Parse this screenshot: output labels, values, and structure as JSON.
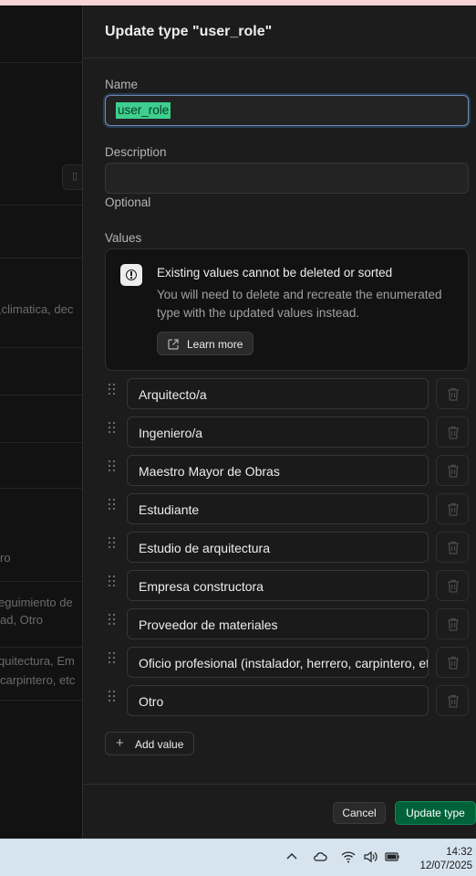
{
  "panel": {
    "title": "Update type \"user_role\"",
    "name_label": "Name",
    "name_value": "user_role",
    "description_label": "Description",
    "description_value": "",
    "description_hint": "Optional",
    "values_label": "Values"
  },
  "notice": {
    "icon": "alert-circle-icon",
    "title": "Existing values cannot be deleted or sorted",
    "text": "You will need to delete and recreate the enumerated type with the updated values instead.",
    "learn_more": "Learn more"
  },
  "values": [
    "Arquitecto/a",
    "Ingeniero/a",
    "Maestro Mayor de Obras",
    "Estudiante",
    "Estudio de arquitectura",
    "Empresa constructora",
    "Proveedor de materiales",
    "Oficio profesional (instalador, herrero, carpintero, etc.)",
    "Otro"
  ],
  "add_value": "Add value",
  "footer": {
    "cancel": "Cancel",
    "submit": "Update type"
  },
  "background": {
    "snippets": [
      ",climatica, dec",
      "ro",
      "eguimiento de",
      "ad, Otro",
      "quitectura, Em",
      "carpintero, etc"
    ]
  },
  "taskbar": {
    "time": "14:32",
    "date": "12/07/2025"
  },
  "colors": {
    "accent": "#3ecf8e",
    "primary_button": "#006239",
    "panel_bg": "#1c1c1c"
  }
}
